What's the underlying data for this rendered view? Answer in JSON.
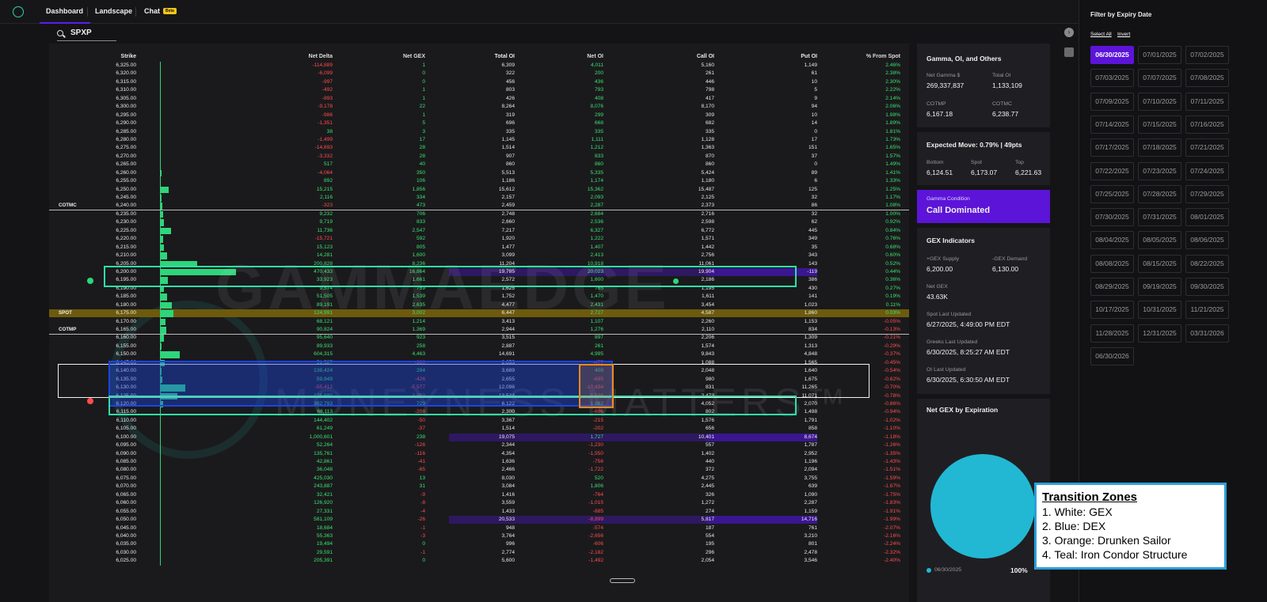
{
  "nav": {
    "dashboard": "Dashboard",
    "landscape": "Landscape",
    "chat": "Chat",
    "chat_badge": "Beta"
  },
  "search": {
    "value": "SPXP"
  },
  "columns": [
    "Strike",
    "Net Delta",
    "Net GEX",
    "Total OI",
    "Net OI",
    "Call OI",
    "Put OI",
    "% From Spot"
  ],
  "rows": [
    {
      "strike": "6,325.00",
      "nd": "-114,889",
      "gex": "1",
      "toi": "6,309",
      "noi": "4,011",
      "coi": "5,160",
      "poi": "1,149",
      "pct": "2.46%",
      "bar": 0
    },
    {
      "strike": "6,320.00",
      "nd": "-6,099",
      "gex": "0",
      "toi": "322",
      "noi": "200",
      "coi": "261",
      "poi": "61",
      "pct": "2.38%",
      "bar": 0
    },
    {
      "strike": "6,315.00",
      "nd": "-997",
      "gex": "0",
      "toi": "456",
      "noi": "436",
      "coi": "446",
      "poi": "10",
      "pct": "2.30%",
      "bar": 0
    },
    {
      "strike": "6,310.00",
      "nd": "-492",
      "gex": "1",
      "toi": "803",
      "noi": "793",
      "coi": "798",
      "poi": "5",
      "pct": "2.22%",
      "bar": 0
    },
    {
      "strike": "6,305.00",
      "nd": "-893",
      "gex": "1",
      "toi": "426",
      "noi": "408",
      "coi": "417",
      "poi": "9",
      "pct": "2.14%",
      "bar": 0
    },
    {
      "strike": "6,300.00",
      "nd": "-9,178",
      "gex": "22",
      "toi": "8,264",
      "noi": "8,076",
      "coi": "8,170",
      "poi": "94",
      "pct": "2.06%",
      "bar": 0
    },
    {
      "strike": "6,295.00",
      "nd": "-986",
      "gex": "1",
      "toi": "319",
      "noi": "299",
      "coi": "309",
      "poi": "10",
      "pct": "1.98%",
      "bar": 0
    },
    {
      "strike": "6,290.00",
      "nd": "-1,351",
      "gex": "5",
      "toi": "696",
      "noi": "668",
      "coi": "682",
      "poi": "14",
      "pct": "1.89%",
      "bar": 0
    },
    {
      "strike": "6,285.00",
      "nd": "38",
      "gex": "3",
      "toi": "335",
      "noi": "335",
      "coi": "335",
      "poi": "0",
      "pct": "1.81%",
      "bar": 0
    },
    {
      "strike": "6,280.00",
      "nd": "-1,499",
      "gex": "17",
      "toi": "1,145",
      "noi": "1,111",
      "coi": "1,128",
      "poi": "17",
      "pct": "1.73%",
      "bar": 0
    },
    {
      "strike": "6,275.00",
      "nd": "-14,693",
      "gex": "28",
      "toi": "1,514",
      "noi": "1,212",
      "coi": "1,363",
      "poi": "151",
      "pct": "1.65%",
      "bar": 0
    },
    {
      "strike": "6,270.00",
      "nd": "-3,332",
      "gex": "28",
      "toi": "907",
      "noi": "833",
      "coi": "870",
      "poi": "37",
      "pct": "1.57%",
      "bar": 0
    },
    {
      "strike": "6,265.00",
      "nd": "517",
      "gex": "40",
      "toi": "860",
      "noi": "860",
      "coi": "860",
      "poi": "0",
      "pct": "1.49%",
      "bar": 0
    },
    {
      "strike": "6,260.00",
      "nd": "-4,064",
      "gex": "350",
      "toi": "5,513",
      "noi": "5,335",
      "coi": "5,424",
      "poi": "89",
      "pct": "1.41%",
      "bar": 0.02
    },
    {
      "strike": "6,255.00",
      "nd": "892",
      "gex": "106",
      "toi": "1,186",
      "noi": "1,174",
      "coi": "1,180",
      "poi": "6",
      "pct": "1.33%",
      "bar": 0.01
    },
    {
      "strike": "6,250.00",
      "nd": "15,215",
      "gex": "1,856",
      "toi": "15,612",
      "noi": "15,362",
      "coi": "15,487",
      "poi": "125",
      "pct": "1.25%",
      "bar": 0.11
    },
    {
      "strike": "6,245.00",
      "nd": "2,116",
      "gex": "334",
      "toi": "2,157",
      "noi": "2,093",
      "coi": "2,125",
      "poi": "32",
      "pct": "1.17%",
      "bar": 0.02
    },
    {
      "strike": "6,240.00",
      "nd": "-323",
      "gex": "473",
      "toi": "2,459",
      "noi": "2,287",
      "coi": "2,373",
      "poi": "86",
      "pct": "1.08%",
      "bar": 0.03,
      "label": "COTMC"
    },
    {
      "strike": "6,235.00",
      "nd": "9,232",
      "gex": "706",
      "toi": "2,748",
      "noi": "2,684",
      "coi": "2,716",
      "poi": "32",
      "pct": "1.00%",
      "bar": 0.04
    },
    {
      "strike": "6,230.00",
      "nd": "9,719",
      "gex": "833",
      "toi": "2,660",
      "noi": "2,536",
      "coi": "2,598",
      "poi": "62",
      "pct": "0.92%",
      "bar": 0.05
    },
    {
      "strike": "6,225.00",
      "nd": "11,736",
      "gex": "2,547",
      "toi": "7,217",
      "noi": "6,327",
      "coi": "6,772",
      "poi": "445",
      "pct": "0.84%",
      "bar": 0.15
    },
    {
      "strike": "6,220.00",
      "nd": "-15,721",
      "gex": "592",
      "toi": "1,920",
      "noi": "1,222",
      "coi": "1,571",
      "poi": "349",
      "pct": "0.76%",
      "bar": 0.04
    },
    {
      "strike": "6,215.00",
      "nd": "15,123",
      "gex": "805",
      "toi": "1,477",
      "noi": "1,407",
      "coi": "1,442",
      "poi": "35",
      "pct": "0.68%",
      "bar": 0.05
    },
    {
      "strike": "6,210.00",
      "nd": "14,281",
      "gex": "1,600",
      "toi": "3,099",
      "noi": "2,413",
      "coi": "2,756",
      "poi": "343",
      "pct": "0.60%",
      "bar": 0.09
    },
    {
      "strike": "6,205.00",
      "nd": "200,828",
      "gex": "8,236",
      "toi": "11,204",
      "noi": "10,918",
      "coi": "11,061",
      "poi": "143",
      "pct": "0.52%",
      "bar": 0.49
    },
    {
      "strike": "6,200.00",
      "nd": "470,433",
      "gex": "16,864",
      "toi": "19,785",
      "noi": "20,023",
      "coi": "19,904",
      "poi": "-119",
      "pct": "0.44%",
      "bar": 1.0,
      "purple": true
    },
    {
      "strike": "6,195.00",
      "nd": "33,923",
      "gex": "1,661",
      "toi": "2,572",
      "noi": "1,600",
      "coi": "2,186",
      "poi": "386",
      "pct": "0.36%",
      "bar": 0.1
    },
    {
      "strike": "6,190.00",
      "nd": "9,574",
      "gex": "759",
      "toi": "1,625",
      "noi": "765",
      "coi": "1,195",
      "poi": "430",
      "pct": "0.27%",
      "bar": 0.05
    },
    {
      "strike": "6,185.00",
      "nd": "51,505",
      "gex": "1,539",
      "toi": "1,752",
      "noi": "1,470",
      "coi": "1,611",
      "poi": "141",
      "pct": "0.19%",
      "bar": 0.09
    },
    {
      "strike": "6,180.00",
      "nd": "89,191",
      "gex": "2,635",
      "toi": "4,477",
      "noi": "2,431",
      "coi": "3,454",
      "poi": "1,023",
      "pct": "0.11%",
      "bar": 0.16
    },
    {
      "strike": "6,175.00",
      "nd": "124,991",
      "gex": "3,002",
      "toi": "6,447",
      "noi": "2,727",
      "coi": "4,587",
      "poi": "1,860",
      "pct": "0.03%",
      "bar": 0.18,
      "label": "SPOT",
      "spot": true
    },
    {
      "strike": "6,170.00",
      "nd": "68,121",
      "gex": "1,214",
      "toi": "3,413",
      "noi": "1,107",
      "coi": "2,260",
      "poi": "1,153",
      "pct": "-0.05%",
      "bar": 0.07
    },
    {
      "strike": "6,165.00",
      "nd": "90,824",
      "gex": "1,369",
      "toi": "2,944",
      "noi": "1,276",
      "coi": "2,110",
      "poi": "834",
      "pct": "-0.13%",
      "bar": 0.08,
      "label": "COTMP"
    },
    {
      "strike": "6,160.00",
      "nd": "95,640",
      "gex": "923",
      "toi": "3,515",
      "noi": "897",
      "coi": "2,206",
      "poi": "1,309",
      "pct": "-0.21%",
      "bar": 0.05
    },
    {
      "strike": "6,155.00",
      "nd": "89,933",
      "gex": "258",
      "toi": "2,887",
      "noi": "261",
      "coi": "1,574",
      "poi": "1,313",
      "pct": "-0.29%",
      "bar": 0.02
    },
    {
      "strike": "6,150.00",
      "nd": "604,315",
      "gex": "4,463",
      "toi": "14,691",
      "noi": "4,995",
      "coi": "9,843",
      "poi": "4,848",
      "pct": "-0.37%",
      "bar": 0.26
    },
    {
      "strike": "6,145.00",
      "nd": "51,527",
      "gex": "-986",
      "toi": "2,653",
      "noi": "-477",
      "coi": "1,088",
      "poi": "1,565",
      "pct": "-0.45%",
      "bar": 0.06
    },
    {
      "strike": "6,140.00",
      "nd": "138,424",
      "gex": "294",
      "toi": "3,689",
      "noi": "408",
      "coi": "2,048",
      "poi": "1,640",
      "pct": "-0.54%",
      "bar": 0.02
    },
    {
      "strike": "6,135.00",
      "nd": "59,949",
      "gex": "-426",
      "toi": "2,655",
      "noi": "-695",
      "coi": "980",
      "poi": "1,675",
      "pct": "-0.62%",
      "bar": 0.03
    },
    {
      "strike": "6,130.00",
      "nd": "-55,412",
      "gex": "-5,577",
      "toi": "12,096",
      "noi": "-10,434",
      "coi": "831",
      "poi": "11,265",
      "pct": "-0.70%",
      "bar": 0.33
    },
    {
      "strike": "6,125.00",
      "nd": "125,680",
      "gex": "-3,850",
      "toi": "13,544",
      "noi": "-8,598",
      "coi": "2,473",
      "poi": "11,071",
      "pct": "-0.78%",
      "bar": 0.23
    },
    {
      "strike": "6,120.00",
      "nd": "382,793",
      "gex": "729",
      "toi": "6,122",
      "noi": "1,982",
      "coi": "4,052",
      "poi": "2,070",
      "pct": "-0.86%",
      "bar": 0.04
    },
    {
      "strike": "6,115.00",
      "nd": "68,113",
      "gex": "-208",
      "toi": "2,300",
      "noi": "-696",
      "coi": "802",
      "poi": "1,498",
      "pct": "-0.94%",
      "bar": 0.01
    },
    {
      "strike": "6,110.00",
      "nd": "144,402",
      "gex": "-50",
      "toi": "3,367",
      "noi": "-215",
      "coi": "1,576",
      "poi": "1,791",
      "pct": "-1.02%",
      "bar": 0
    },
    {
      "strike": "6,105.00",
      "nd": "61,249",
      "gex": "-37",
      "toi": "1,514",
      "noi": "-202",
      "coi": "656",
      "poi": "858",
      "pct": "-1.10%",
      "bar": 0
    },
    {
      "strike": "6,100.00",
      "nd": "1,000,601",
      "gex": "238",
      "toi": "19,075",
      "noi": "1,727",
      "coi": "10,401",
      "poi": "8,674",
      "pct": "-1.18%",
      "bar": 0.01,
      "purple": true
    },
    {
      "strike": "6,095.00",
      "nd": "52,264",
      "gex": "-126",
      "toi": "2,344",
      "noi": "-1,230",
      "coi": "557",
      "poi": "1,787",
      "pct": "-1.26%",
      "bar": 0
    },
    {
      "strike": "6,090.00",
      "nd": "135,761",
      "gex": "-116",
      "toi": "4,354",
      "noi": "-1,550",
      "coi": "1,402",
      "poi": "2,952",
      "pct": "-1.35%",
      "bar": 0
    },
    {
      "strike": "6,085.00",
      "nd": "42,861",
      "gex": "-41",
      "toi": "1,636",
      "noi": "-756",
      "coi": "440",
      "poi": "1,196",
      "pct": "-1.43%",
      "bar": 0
    },
    {
      "strike": "6,080.00",
      "nd": "36,048",
      "gex": "-65",
      "toi": "2,466",
      "noi": "-1,722",
      "coi": "372",
      "poi": "2,094",
      "pct": "-1.51%",
      "bar": 0
    },
    {
      "strike": "6,075.00",
      "nd": "425,030",
      "gex": "13",
      "toi": "8,030",
      "noi": "520",
      "coi": "4,275",
      "poi": "3,755",
      "pct": "-1.59%",
      "bar": 0
    },
    {
      "strike": "6,070.00",
      "nd": "243,887",
      "gex": "31",
      "toi": "3,084",
      "noi": "1,806",
      "coi": "2,445",
      "poi": "639",
      "pct": "-1.67%",
      "bar": 0
    },
    {
      "strike": "6,065.00",
      "nd": "32,421",
      "gex": "-9",
      "toi": "1,416",
      "noi": "-764",
      "coi": "326",
      "poi": "1,090",
      "pct": "-1.75%",
      "bar": 0
    },
    {
      "strike": "6,060.00",
      "nd": "126,920",
      "gex": "-8",
      "toi": "3,559",
      "noi": "-1,015",
      "coi": "1,272",
      "poi": "2,287",
      "pct": "-1.83%",
      "bar": 0
    },
    {
      "strike": "6,055.00",
      "nd": "27,331",
      "gex": "-4",
      "toi": "1,433",
      "noi": "-885",
      "coi": "274",
      "poi": "1,159",
      "pct": "-1.91%",
      "bar": 0
    },
    {
      "strike": "6,050.00",
      "nd": "581,109",
      "gex": "-26",
      "toi": "20,533",
      "noi": "-8,899",
      "coi": "5,817",
      "poi": "14,716",
      "pct": "-1.99%",
      "bar": 0,
      "purple": true
    },
    {
      "strike": "6,045.00",
      "nd": "18,684",
      "gex": "-1",
      "toi": "948",
      "noi": "-574",
      "coi": "187",
      "poi": "761",
      "pct": "-2.07%",
      "bar": 0
    },
    {
      "strike": "6,040.00",
      "nd": "55,363",
      "gex": "-3",
      "toi": "3,764",
      "noi": "-2,656",
      "coi": "554",
      "poi": "3,210",
      "pct": "-2.16%",
      "bar": 0
    },
    {
      "strike": "6,035.00",
      "nd": "19,494",
      "gex": "0",
      "toi": "996",
      "noi": "-606",
      "coi": "195",
      "poi": "801",
      "pct": "-2.24%",
      "bar": 0
    },
    {
      "strike": "6,030.00",
      "nd": "29,591",
      "gex": "-1",
      "toi": "2,774",
      "noi": "-2,182",
      "coi": "296",
      "poi": "2,478",
      "pct": "-2.32%",
      "bar": 0
    },
    {
      "strike": "6,025.00",
      "nd": "205,391",
      "gex": "0",
      "toi": "5,600",
      "noi": "-1,492",
      "coi": "2,054",
      "poi": "3,546",
      "pct": "-2.40%",
      "bar": 0
    }
  ],
  "watermark": {
    "line1": "GAMMAEDGE",
    "line2": "MONEYNESS MATTERS™"
  },
  "gamma_card": {
    "title": "Gamma, OI, and Others",
    "net_gamma_label": "Net Gamma $",
    "net_gamma": "269,337,837",
    "total_oi_label": "Total OI",
    "total_oi": "1,133,109",
    "cotmp_label": "COTMP",
    "cotmp": "6,167.18",
    "cotmc_label": "COTMC",
    "cotmc": "6,238.77"
  },
  "expected_move": {
    "title": "Expected Move: 0.79% | 49pts",
    "bottom_label": "Bottom",
    "bottom": "6,124.51",
    "spot_label": "Spot",
    "spot": "6,173.07",
    "top_label": "Top",
    "top": "6,221.63"
  },
  "gamma_condition": {
    "label": "Gamma Condition",
    "value": "Call Dominated"
  },
  "gex_indicators": {
    "title": "GEX Indicators",
    "supply_label": "+GEX Supply",
    "supply": "6,200.00",
    "demand_label": "-GEX Demand",
    "demand": "6,130.00",
    "net_label": "Net GEX",
    "net": "43.63K",
    "spot_updated_label": "Spot Last Updated",
    "spot_updated": "6/27/2025, 4:49:00 PM EDT",
    "greeks_updated_label": "Greeks Last Updated",
    "greeks_updated": "6/30/2025, 8:25:27 AM EDT",
    "oi_updated_label": "OI Last Updated",
    "oi_updated": "6/30/2025, 6:30:50 AM EDT"
  },
  "net_gex_exp": {
    "title": "Net GEX by Expiration",
    "legend_label": "06/30/2025",
    "legend_pct": "100%",
    "slice_color": "#22b8d4"
  },
  "sidebar": {
    "title": "Filter by Expiry Date",
    "select_all": "Select All",
    "invert": "Invert",
    "dates": [
      "06/30/2025",
      "07/01/2025",
      "07/02/2025",
      "07/03/2025",
      "07/07/2025",
      "07/08/2025",
      "07/09/2025",
      "07/10/2025",
      "07/11/2025",
      "07/14/2025",
      "07/15/2025",
      "07/16/2025",
      "07/17/2025",
      "07/18/2025",
      "07/21/2025",
      "07/22/2025",
      "07/23/2025",
      "07/24/2025",
      "07/25/2025",
      "07/28/2025",
      "07/29/2025",
      "07/30/2025",
      "07/31/2025",
      "08/01/2025",
      "08/04/2025",
      "08/05/2025",
      "08/06/2025",
      "08/08/2025",
      "08/15/2025",
      "08/22/2025",
      "08/29/2025",
      "09/19/2025",
      "09/30/2025",
      "10/17/2025",
      "10/31/2025",
      "11/21/2025",
      "11/28/2025",
      "12/31/2025",
      "03/31/2026",
      "06/30/2026"
    ],
    "selected": "06/30/2025"
  },
  "transition_zones": {
    "title": "Transition Zones",
    "items": [
      "1. White: GEX",
      "2. Blue: DEX",
      "3. Orange: Drunken Sailor",
      "4. Teal: Iron Condor Structure"
    ]
  },
  "colors": {
    "accent": "#5b14d8",
    "positive": "#3be36d",
    "negative": "#ff4d4d",
    "teal": "#2ee0a8",
    "blue": "#1d44e0",
    "orange": "#f08a1a",
    "spot": "#6e5a0c"
  }
}
